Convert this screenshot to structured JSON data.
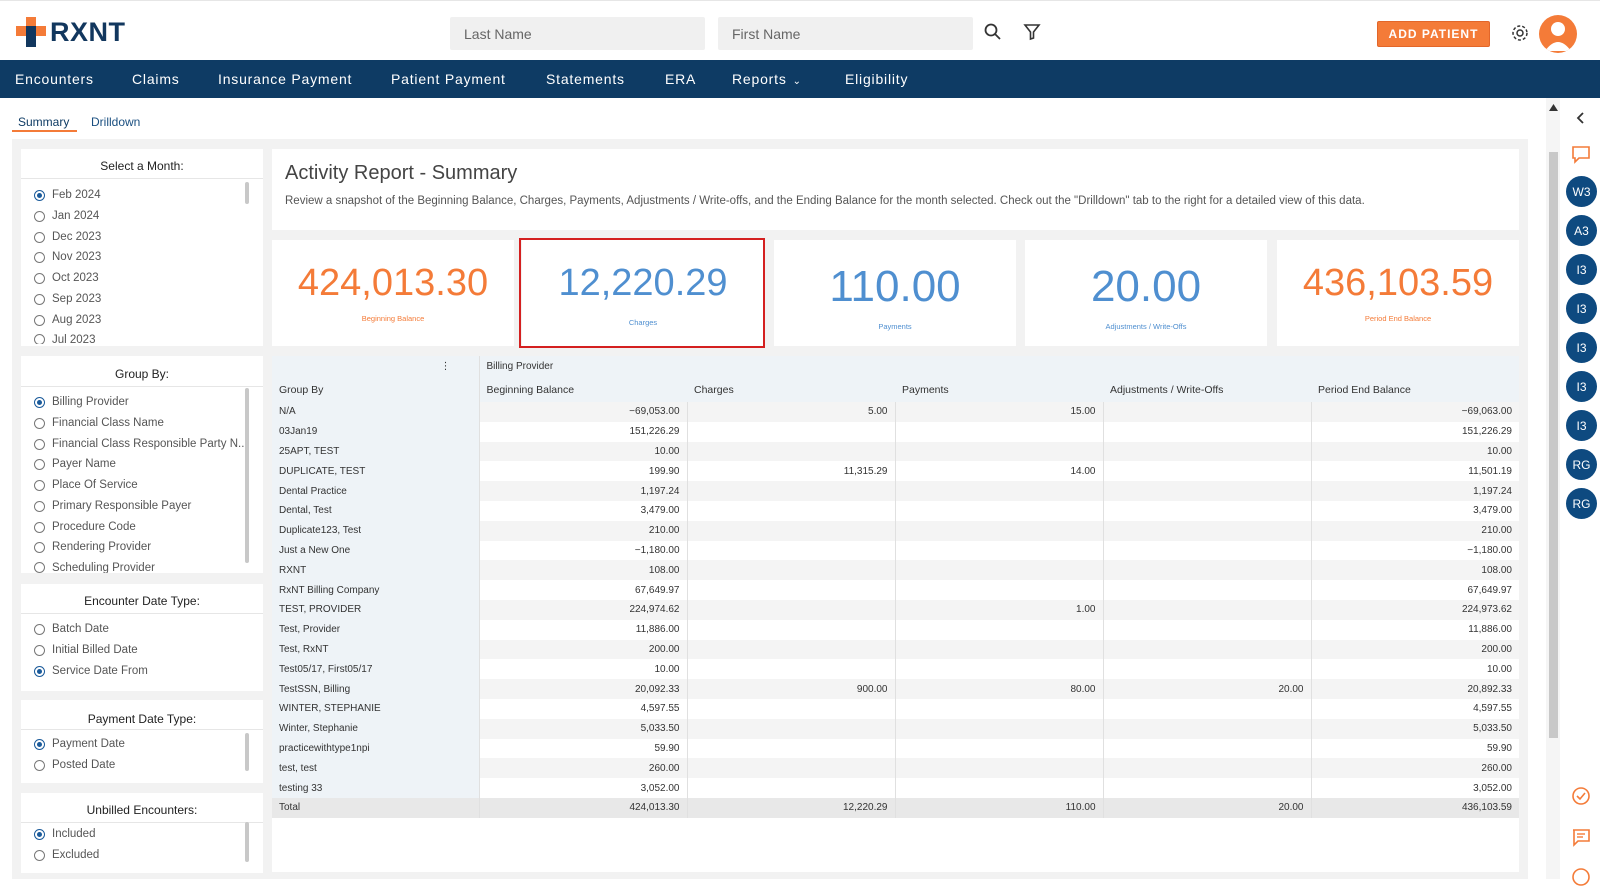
{
  "header": {
    "logo_text": "RXNT",
    "last_name_placeholder": "Last Name",
    "first_name_placeholder": "First Name",
    "add_patient_label": "ADD PATIENT"
  },
  "nav": {
    "items": [
      "Encounters",
      "Claims",
      "Insurance Payment",
      "Patient Payment",
      "Statements",
      "ERA",
      "Reports",
      "Eligibility"
    ]
  },
  "tabs": {
    "summary": "Summary",
    "drilldown": "Drilldown"
  },
  "filters": {
    "month": {
      "title": "Select a Month:",
      "options": [
        "Feb 2024",
        "Jan 2024",
        "Dec 2023",
        "Nov 2023",
        "Oct 2023",
        "Sep 2023",
        "Aug 2023",
        "Jul 2023"
      ],
      "selected": "Feb 2024"
    },
    "group_by": {
      "title": "Group By:",
      "options": [
        "Billing Provider",
        "Financial Class Name",
        "Financial Class Responsible Party N...",
        "Payer Name",
        "Place Of Service",
        "Primary Responsible Payer",
        "Procedure Code",
        "Rendering Provider",
        "Scheduling Provider"
      ],
      "selected": "Billing Provider"
    },
    "encounter_date_type": {
      "title": "Encounter Date Type:",
      "options": [
        "Batch Date",
        "Initial Billed Date",
        "Service Date From"
      ],
      "selected": "Service Date From"
    },
    "payment_date_type": {
      "title": "Payment Date Type:",
      "options": [
        "Payment Date",
        "Posted Date"
      ],
      "selected": "Payment Date"
    },
    "unbilled_encounters": {
      "title": "Unbilled Encounters:",
      "options": [
        "Included",
        "Excluded"
      ],
      "selected": "Included"
    }
  },
  "report": {
    "title": "Activity Report - Summary",
    "description": "Review a snapshot of the Beginning Balance, Charges, Payments, Adjustments / Write-offs, and the Ending Balance for the month selected. Check out the \"Drilldown\" tab to the right for a detailed view of this data."
  },
  "kpis": [
    {
      "value": "424,013.30",
      "label": "Beginning Balance",
      "color": "#f47b38"
    },
    {
      "value": "12,220.29",
      "label": "Charges",
      "color": "#4f8fd0"
    },
    {
      "value": "110.00",
      "label": "Payments",
      "color": "#4f8fd0"
    },
    {
      "value": "20.00",
      "label": "Adjustments / Write-Offs",
      "color": "#4f8fd0"
    },
    {
      "value": "436,103.59",
      "label": "Period End Balance",
      "color": "#f47b38"
    }
  ],
  "table": {
    "pivot_header": "Billing Provider",
    "columns": [
      "Group By",
      "Beginning Balance",
      "Charges",
      "Payments",
      "Adjustments / Write-Offs",
      "Period End Balance"
    ],
    "rows": [
      [
        "N/A",
        "−69,053.00",
        "5.00",
        "15.00",
        "",
        "−69,063.00"
      ],
      [
        "03Jan19",
        "151,226.29",
        "",
        "",
        "",
        "151,226.29"
      ],
      [
        "25APT, TEST",
        "10.00",
        "",
        "",
        "",
        "10.00"
      ],
      [
        "DUPLICATE, TEST",
        "199.90",
        "11,315.29",
        "14.00",
        "",
        "11,501.19"
      ],
      [
        "Dental Practice",
        "1,197.24",
        "",
        "",
        "",
        "1,197.24"
      ],
      [
        "Dental, Test",
        "3,479.00",
        "",
        "",
        "",
        "3,479.00"
      ],
      [
        "Duplicate123, Test",
        "210.00",
        "",
        "",
        "",
        "210.00"
      ],
      [
        "Just a New One",
        "−1,180.00",
        "",
        "",
        "",
        "−1,180.00"
      ],
      [
        "RXNT",
        "108.00",
        "",
        "",
        "",
        "108.00"
      ],
      [
        "RxNT Billing Company",
        "67,649.97",
        "",
        "",
        "",
        "67,649.97"
      ],
      [
        "TEST, PROVIDER",
        "224,974.62",
        "",
        "1.00",
        "",
        "224,973.62"
      ],
      [
        "Test, Provider",
        "11,886.00",
        "",
        "",
        "",
        "11,886.00"
      ],
      [
        "Test, RxNT",
        "200.00",
        "",
        "",
        "",
        "200.00"
      ],
      [
        "Test05/17, First05/17",
        "10.00",
        "",
        "",
        "",
        "10.00"
      ],
      [
        "TestSSN, Billing",
        "20,092.33",
        "900.00",
        "80.00",
        "20.00",
        "20,892.33"
      ],
      [
        "WINTER, STEPHANIE",
        "4,597.55",
        "",
        "",
        "",
        "4,597.55"
      ],
      [
        "Winter, Stephanie",
        "5,033.50",
        "",
        "",
        "",
        "5,033.50"
      ],
      [
        "practicewithtype1npi",
        "59.90",
        "",
        "",
        "",
        "59.90"
      ],
      [
        "test, test",
        "260.00",
        "",
        "",
        "",
        "260.00"
      ],
      [
        "testing 33",
        "3,052.00",
        "",
        "",
        "",
        "3,052.00"
      ]
    ],
    "total": [
      "Total",
      "424,013.30",
      "12,220.29",
      "110.00",
      "20.00",
      "436,103.59"
    ]
  },
  "right_sidebar": {
    "badges": [
      "W3",
      "A3",
      "I3",
      "I3",
      "I3",
      "I3",
      "I3",
      "RG",
      "RG"
    ]
  }
}
